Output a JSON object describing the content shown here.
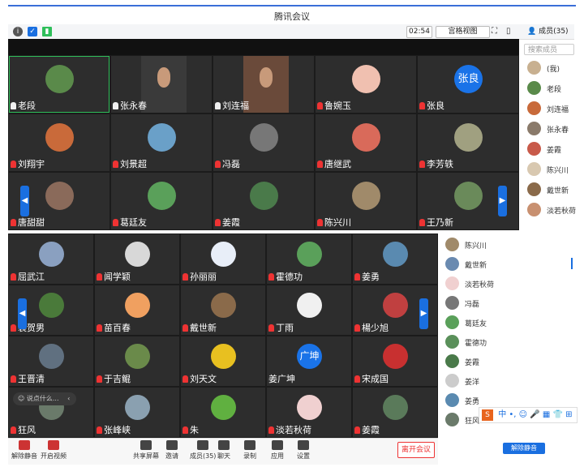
{
  "app_title": "腾讯会议",
  "toolbar": {
    "timer": "02:54",
    "grid_view": "宫格视图",
    "members": "成员(35)"
  },
  "top_grid": {
    "rows": [
      [
        {
          "name": "老段",
          "mic": "on",
          "color": "#5a8a4a"
        },
        {
          "name": "张永春",
          "mic": "on",
          "color": "#3a3a3a",
          "video": true
        },
        {
          "name": "刘连福",
          "mic": "on",
          "color": "#6a4a3a",
          "video": true
        },
        {
          "name": "鲁婉玉",
          "mic": "off",
          "color": "#f0c0b0"
        },
        {
          "name": "张良",
          "mic": "off",
          "color": "#1a73e8",
          "text": "张良"
        }
      ],
      [
        {
          "name": "刘翔宇",
          "mic": "off",
          "color": "#c96a3a"
        },
        {
          "name": "刘景超",
          "mic": "off",
          "color": "#6aa0c8"
        },
        {
          "name": "冯磊",
          "mic": "off",
          "color": "#777"
        },
        {
          "name": "唐继武",
          "mic": "off",
          "color": "#d96a5a"
        },
        {
          "name": "李芳轶",
          "mic": "off",
          "color": "#a0a080"
        }
      ],
      [
        {
          "name": "唐甜甜",
          "mic": "off",
          "color": "#8a6a5a"
        },
        {
          "name": "葛廷友",
          "mic": "off",
          "color": "#5aa05a"
        },
        {
          "name": "姜霞",
          "mic": "off",
          "color": "#4a7a4a"
        },
        {
          "name": "陈兴川",
          "mic": "off",
          "color": "#a08a6a"
        },
        {
          "name": "王乃新",
          "mic": "off",
          "color": "#6a8a5a"
        }
      ]
    ]
  },
  "bottom_grid": {
    "rows": [
      [
        {
          "name": "屈武江",
          "mic": "off",
          "color": "#8aa0c0"
        },
        {
          "name": "闻学颖",
          "mic": "off",
          "color": "#d8d8d8"
        },
        {
          "name": "孙丽丽",
          "mic": "off",
          "color": "#e8eef8"
        },
        {
          "name": "霍德功",
          "mic": "off",
          "color": "#5aa05a"
        },
        {
          "name": "姜勇",
          "mic": "off",
          "color": "#5a8ab0"
        }
      ],
      [
        {
          "name": "裴贺男",
          "mic": "off",
          "color": "#4a7a3a"
        },
        {
          "name": "苗百春",
          "mic": "off",
          "color": "#f0a060"
        },
        {
          "name": "戴世新",
          "mic": "off",
          "color": "#8a6a4a"
        },
        {
          "name": "丁雨",
          "mic": "off",
          "color": "#f0f0f0"
        },
        {
          "name": "楊少旭",
          "mic": "off",
          "color": "#c04040"
        }
      ],
      [
        {
          "name": "王晋清",
          "mic": "off",
          "color": "#607080"
        },
        {
          "name": "于吉鲲",
          "mic": "off",
          "color": "#6a8a4a"
        },
        {
          "name": "刘天文",
          "mic": "off",
          "color": "#e8c020"
        },
        {
          "name": "姜广坤",
          "mic": "none",
          "color": "#1a73e8",
          "text": "广坤"
        },
        {
          "name": "宋成国",
          "mic": "off",
          "color": "#c83030"
        }
      ],
      [
        {
          "name": "狂风",
          "mic": "off",
          "color": "#6a7a6a"
        },
        {
          "name": "张峰峡",
          "mic": "off",
          "color": "#8aa0b0"
        },
        {
          "name": "朱",
          "mic": "off",
          "color": "#60b040"
        },
        {
          "name": "淡若秋荷",
          "mic": "off",
          "color": "#f0d0d0"
        },
        {
          "name": "姜霞",
          "mic": "off",
          "color": "#5a7a5a"
        }
      ]
    ]
  },
  "panel_top": {
    "search_placeholder": "搜索成员",
    "items": [
      {
        "name": "(我)",
        "color": "#c8b090"
      },
      {
        "name": "老段",
        "color": "#5a8a4a"
      },
      {
        "name": "刘连福",
        "color": "#c86a3a"
      },
      {
        "name": "张永春",
        "color": "#8a7a6a"
      },
      {
        "name": "姜霞",
        "color": "#c85a4a"
      },
      {
        "name": "陈兴川",
        "color": "#d8c8b0"
      },
      {
        "name": "戴世新",
        "color": "#8a6a4a"
      },
      {
        "name": "淡若秋荷",
        "color": "#c89070"
      }
    ]
  },
  "panel_bottom": {
    "items": [
      {
        "name": "陈兴川",
        "color": "#a08a6a"
      },
      {
        "name": "戴世新",
        "color": "#6a8ab0"
      },
      {
        "name": "淡若秋荷",
        "color": "#f0d0d0"
      },
      {
        "name": "冯磊",
        "color": "#777"
      },
      {
        "name": "葛廷友",
        "color": "#5aa05a"
      },
      {
        "name": "霍德功",
        "color": "#5a905a"
      },
      {
        "name": "姜霞",
        "color": "#4a7a4a"
      },
      {
        "name": "姜洋",
        "color": "#ccc"
      },
      {
        "name": "姜勇",
        "color": "#5a8ab0"
      },
      {
        "name": "狂风",
        "color": "#6a7a6a"
      }
    ],
    "unmute_all": "解除静音"
  },
  "chat_placeholder": "说点什么...",
  "bottom_toolbar": {
    "items": [
      "解除静音",
      "开启视频",
      "共享屏幕",
      "邀请",
      "成员(35)",
      "聊天",
      "录制",
      "应用",
      "设置"
    ],
    "leave": "离开会议"
  },
  "ime": "中 •, ☺ 🎤 ▦ 👕 ⊞"
}
